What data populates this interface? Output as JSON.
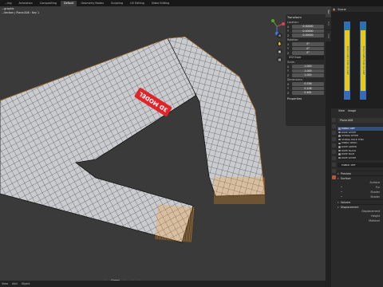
{
  "workspace_tabs": [
    {
      "label": "...ing"
    },
    {
      "label": "Animation"
    },
    {
      "label": "Compositing"
    },
    {
      "label": "Default",
      "active": true
    },
    {
      "label": "Geometry Nodes"
    },
    {
      "label": "Scripting"
    },
    {
      "label": "UV Editing"
    },
    {
      "label": "Video Editing"
    }
  ],
  "viewport": {
    "view_mode": "...graphic",
    "object_info": "...llection | Plane.008 : Key 1",
    "tag_text": "3D MODEL"
  },
  "npanel": {
    "transform_header": "Transform",
    "location_label": "Location:",
    "location": [
      {
        "axis": "X",
        "value": "0.00000"
      },
      {
        "axis": "Y",
        "value": "0.00000"
      },
      {
        "axis": "Z",
        "value": "0.00000"
      }
    ],
    "rotation_label": "Rotation:",
    "rotation": [
      {
        "axis": "X",
        "value": "0°"
      },
      {
        "axis": "Y",
        "value": "0°"
      },
      {
        "axis": "Z",
        "value": "0°"
      }
    ],
    "rotation_mode": "XYZ Euler",
    "scale_label": "Scale:",
    "scale": [
      {
        "axis": "X",
        "value": "1.000"
      },
      {
        "axis": "Y",
        "value": "1.000"
      },
      {
        "axis": "Z",
        "value": "1.000"
      }
    ],
    "dimensions_label": "Dimensions:",
    "dimensions": [
      {
        "axis": "X",
        "value": "0.536"
      },
      {
        "axis": "Y",
        "value": "0.108"
      },
      {
        "axis": "Z",
        "value": "0.461"
      }
    ],
    "properties_header": "Properties"
  },
  "side_tabs": [
    "Item",
    "Tool",
    "View"
  ],
  "image_editor": {
    "header_label": "Scene",
    "texture_text": "MACCABI FAN SCARF"
  },
  "properties": {
    "menu": [
      "View",
      "Image"
    ],
    "object_name": "Plane.008",
    "material_slots": [
      {
        "name": "FABRIC DEF",
        "selected": true
      },
      {
        "name": "ROPE WHITE"
      },
      {
        "name": "STRING WHITE"
      },
      {
        "name": "STRING HOLE THIN"
      },
      {
        "name": "FABRIC REDD"
      },
      {
        "name": "ROPE GREEN"
      },
      {
        "name": "ROPE BLACK"
      },
      {
        "name": "ROPE BLUE"
      },
      {
        "name": "ROPE WHITE"
      }
    ],
    "material_field": "FABRIC DEF",
    "preview_label": "Preview",
    "surface_label": "Surface",
    "surface_value": "Surface",
    "rows": [
      {
        "label": "",
        "value": "Fur"
      },
      {
        "label": "",
        "value": "Shader"
      },
      {
        "label": "",
        "value": "Shader"
      }
    ],
    "volume_label": "Volume",
    "displacement_label": "Displacement",
    "displacement_value": "Displacement",
    "height_label": "Height",
    "midlevel_label": "Midlevel"
  },
  "statusbar": {
    "items": [
      "View",
      "Add",
      "Object"
    ],
    "transform_orientation": "Global"
  },
  "colors": {
    "mesh_fill": "#c9cbcf",
    "wireframe": "#1a1a1a",
    "selection_outline": "#ff9a1f",
    "tag_red": "#e0252a",
    "active_tab": "#3d3d3d"
  }
}
